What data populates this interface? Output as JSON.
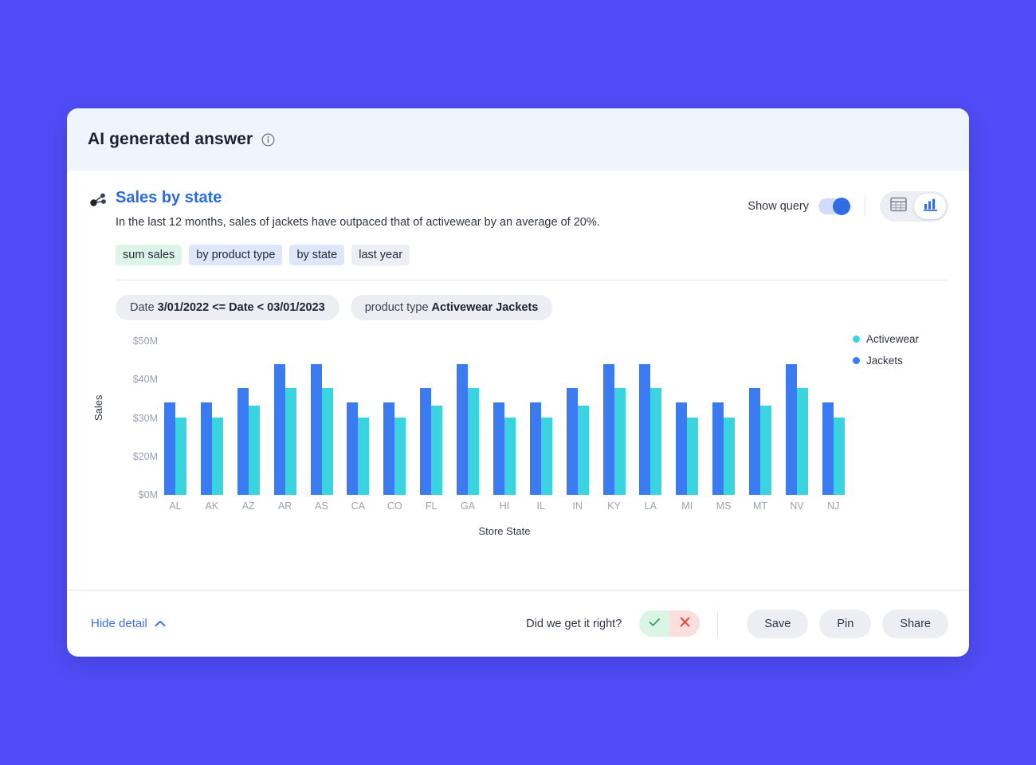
{
  "banner": {
    "title": "AI generated answer",
    "info_icon": "info-circle-icon"
  },
  "answer": {
    "icon": "share-nodes-icon",
    "title": "Sales by state",
    "subtitle": "In the last 12 months, sales of jackets have outpaced that of activewear by an average of 20%."
  },
  "controls": {
    "show_query_label": "Show query",
    "show_query_on": true,
    "table_view_icon": "table-icon",
    "chart_view_icon": "bar-chart-icon"
  },
  "chips": [
    {
      "label": "sum sales",
      "tone": "green"
    },
    {
      "label": "by product type",
      "tone": "blue"
    },
    {
      "label": "by state",
      "tone": "blue"
    },
    {
      "label": "last year",
      "tone": "grey"
    }
  ],
  "filters": [
    {
      "prefix": "Date",
      "value": "3/01/2022 <= Date < 03/01/2023"
    },
    {
      "prefix": "product type",
      "value": "Activewear Jackets"
    }
  ],
  "footer": {
    "hide_detail_label": "Hide detail",
    "chevron_icon": "chevron-up-icon",
    "feedback_question": "Did we get it right?",
    "thumbs_up_icon": "check-icon",
    "thumbs_down_icon": "close-icon",
    "save_label": "Save",
    "pin_label": "Pin",
    "share_label": "Share"
  },
  "colors": {
    "page_background": "#4f4cf7",
    "banner_background": "#eef5fd",
    "accent_blue": "#2a6be0",
    "jackets": "#3b7bf2",
    "activewear": "#3ad4e0",
    "chip_green": "#ddf5e8",
    "chip_blue": "#dde6fb",
    "chip_grey": "#eceef4"
  },
  "chart_data": {
    "type": "bar",
    "title": "Sales by state",
    "xlabel": "Store State",
    "ylabel": "Sales",
    "ylim": [
      0,
      55
    ],
    "ytick_labels": [
      "$50M",
      "$40M",
      "$30M",
      "$20M",
      "$0M"
    ],
    "ytick_values": [
      50,
      40,
      30,
      20,
      0
    ],
    "grid": false,
    "legend_position": "right",
    "categories": [
      "AL",
      "AK",
      "AZ",
      "AR",
      "AS",
      "CA",
      "CO",
      "FL",
      "GA",
      "HI",
      "IL",
      "IN",
      "KY",
      "LA",
      "MI",
      "MS",
      "MT",
      "NV",
      "NJ"
    ],
    "series": [
      {
        "name": "Jackets",
        "color": "#3b7bf2",
        "values": [
          31,
          31,
          36,
          44,
          44,
          31,
          31,
          36,
          44,
          31,
          31,
          36,
          44,
          44,
          31,
          31,
          36,
          44,
          31
        ]
      },
      {
        "name": "Activewear",
        "color": "#3ad4e0",
        "values": [
          26,
          26,
          30,
          36,
          36,
          26,
          26,
          30,
          36,
          26,
          26,
          30,
          36,
          36,
          26,
          26,
          30,
          36,
          26
        ]
      }
    ]
  }
}
